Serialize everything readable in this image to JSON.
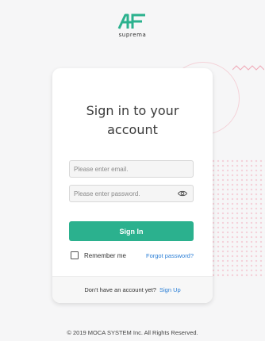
{
  "brand": {
    "name": "suprema",
    "accent_color": "#2bb18e",
    "link_color": "#2c7fd6"
  },
  "card": {
    "title_line1": "Sign in to your",
    "title_line2": "account"
  },
  "form": {
    "email_placeholder": "Please enter email.",
    "password_placeholder": "Please enter password.",
    "signin_label": "Sign In",
    "remember_label": "Remember me",
    "remember_checked": false,
    "forgot_label": "Forgot password?"
  },
  "footer": {
    "no_account_text": "Don't have an account yet?",
    "signup_label": "Sign Up"
  },
  "copyright": "© 2019 MOCA SYSTEM Inc. All Rights Reserved."
}
